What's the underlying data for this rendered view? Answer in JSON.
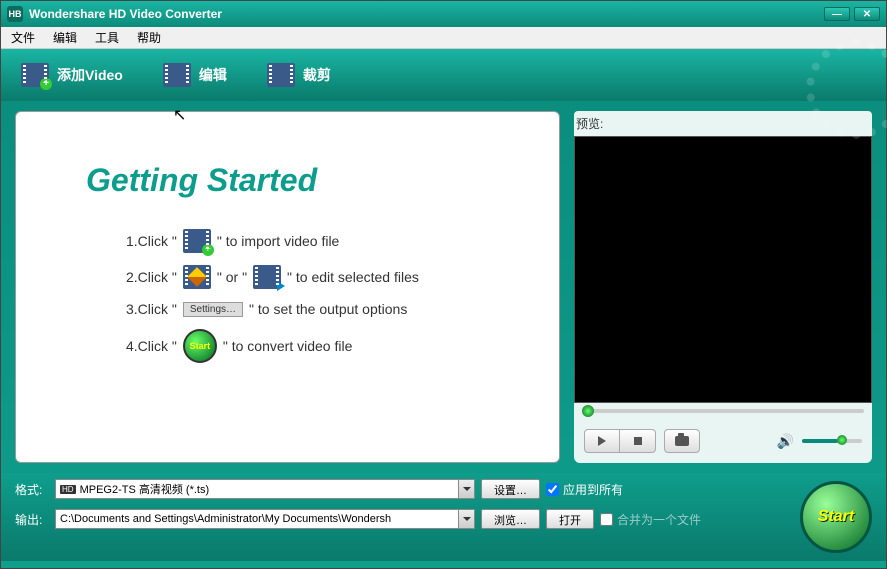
{
  "title": "Wondershare HD Video Converter",
  "logo": "HB",
  "menu": [
    "文件",
    "编辑",
    "工具",
    "帮助"
  ],
  "toolbar": {
    "add": "添加Video",
    "edit": "编辑",
    "crop": "裁剪"
  },
  "getting_started": {
    "title": "Getting Started",
    "step1_prefix": "1.Click \"",
    "step1_suffix": "\" to import video file",
    "step2_prefix": "2.Click \"",
    "step2_or": "\" or \"",
    "step2_suffix": "\" to edit selected files",
    "step3_prefix": "3.Click \"",
    "step3_settings": "Settings…",
    "step3_suffix": "\" to set the output options",
    "step4_prefix": "4.Click \"",
    "step4_start": "Start",
    "step4_suffix": "\" to convert video file"
  },
  "preview": {
    "label": "预览:"
  },
  "bottom": {
    "format_label": "格式:",
    "format_value": "MPEG2-TS 高清视频 (*.ts)",
    "format_badge": "HD",
    "settings_btn": "设置…",
    "apply_all": "应用到所有",
    "output_label": "输出:",
    "output_value": "C:\\Documents and Settings\\Administrator\\My Documents\\Wondersh",
    "browse_btn": "浏览…",
    "open_btn": "打开",
    "merge": "合并为一个文件"
  },
  "start_label": "Start"
}
